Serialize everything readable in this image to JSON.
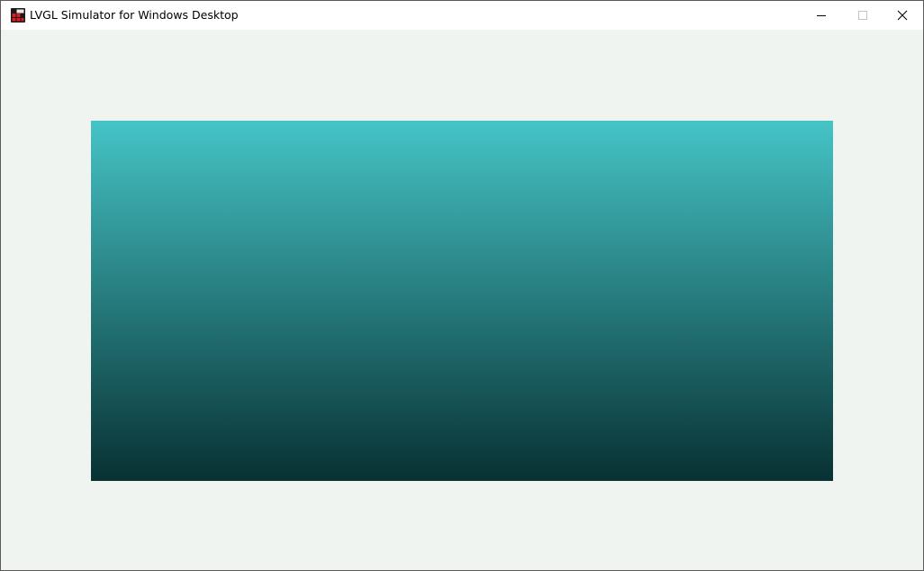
{
  "window": {
    "title": "LVGL Simulator for Windows Desktop",
    "icons": {
      "app": "lvgl-app-icon",
      "minimize": "minimize-icon",
      "maximize": "maximize-icon",
      "close": "close-icon"
    }
  },
  "canvas": {
    "background_color": "#f0f4f1",
    "gradient_object": {
      "top_color": "#45c4c6",
      "bottom_color": "#083133",
      "direction": "vertical"
    }
  }
}
